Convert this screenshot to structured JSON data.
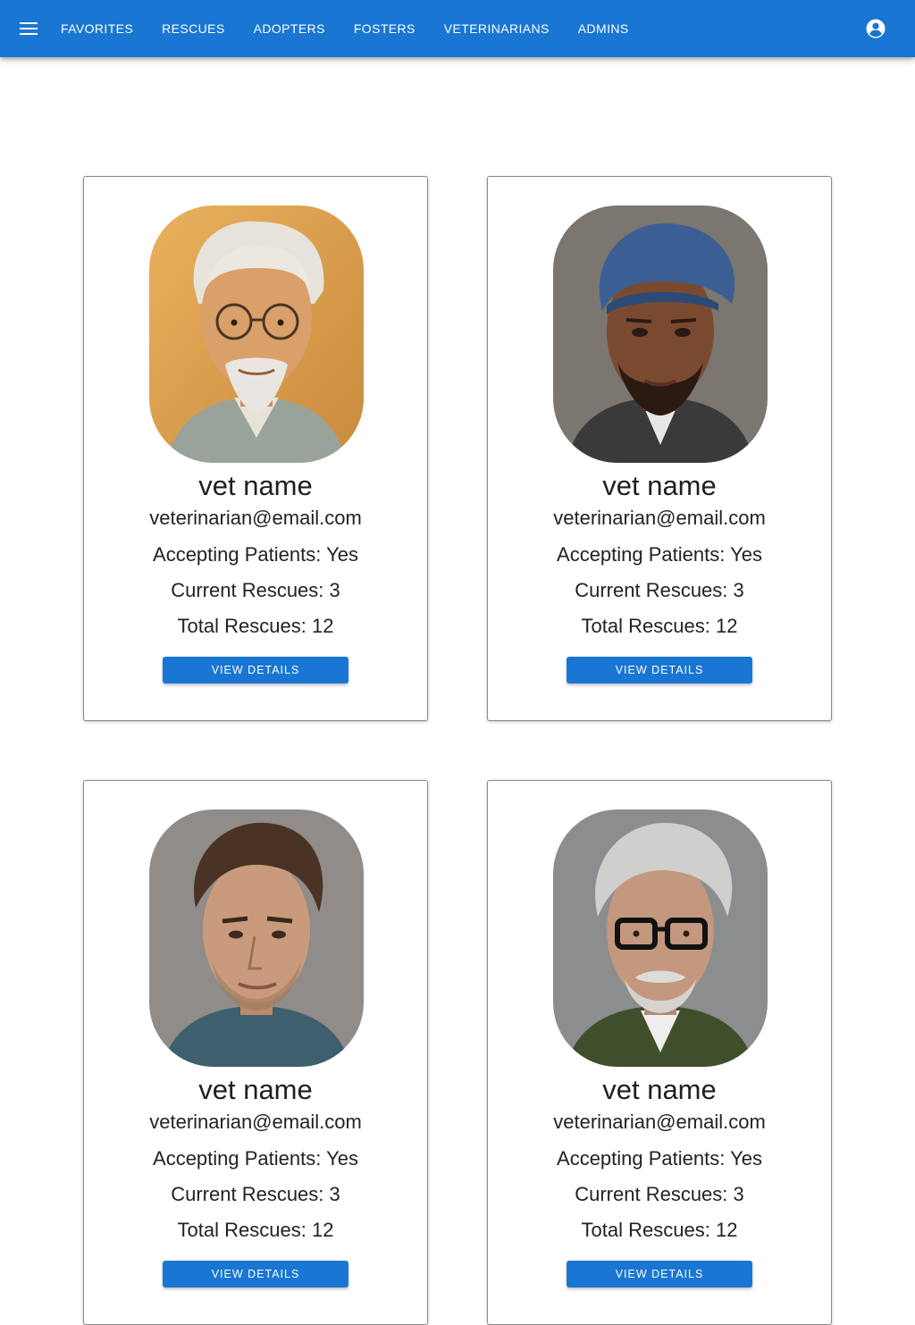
{
  "colors": {
    "primary": "#1976d2",
    "card_border": "#8a8a8a"
  },
  "appbar": {
    "menu_icon": "menu-icon",
    "account_icon": "account-circle-icon",
    "nav": [
      "FAVORITES",
      "RESCUES",
      "ADOPTERS",
      "FOSTERS",
      "VETERINARIANS",
      "ADMINS"
    ]
  },
  "vets": [
    {
      "name": "vet name",
      "email": "veterinarian@email.com",
      "accepting_label": "Accepting Patients:",
      "accepting": "Yes",
      "current_label": "Current Rescues:",
      "current": "3",
      "total_label": "Total Rescues:",
      "total": "12",
      "button": "VIEW DETAILS",
      "photo": "older man with glasses portrait"
    },
    {
      "name": "vet name",
      "email": "veterinarian@email.com",
      "accepting_label": "Accepting Patients:",
      "accepting": "Yes",
      "current_label": "Current Rescues:",
      "current": "3",
      "total_label": "Total Rescues:",
      "total": "12",
      "button": "VIEW DETAILS",
      "photo": "man in blue flat cap portrait"
    },
    {
      "name": "vet name",
      "email": "veterinarian@email.com",
      "accepting_label": "Accepting Patients:",
      "accepting": "Yes",
      "current_label": "Current Rescues:",
      "current": "3",
      "total_label": "Total Rescues:",
      "total": "12",
      "button": "VIEW DETAILS",
      "photo": "young man portrait"
    },
    {
      "name": "vet name",
      "email": "veterinarian@email.com",
      "accepting_label": "Accepting Patients:",
      "accepting": "Yes",
      "current_label": "Current Rescues:",
      "current": "3",
      "total_label": "Total Rescues:",
      "total": "12",
      "button": "VIEW DETAILS",
      "photo": "older man with black glasses portrait"
    }
  ]
}
